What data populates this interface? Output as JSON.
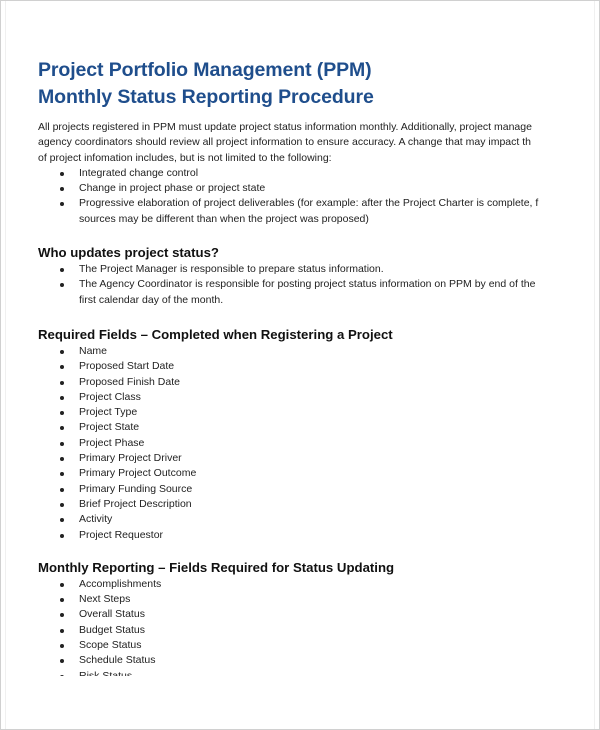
{
  "document": {
    "title_line1": "Project Portfolio Management (PPM)",
    "title_line2": "Monthly Status Reporting Procedure",
    "intro_lines": [
      "All projects registered in PPM must update project status information monthly. Additionally, project manage",
      "agency coordinators should review all project information to ensure accuracy. A change that may impact th",
      "of project infomation includes, but is not limited to the following:"
    ],
    "intro_bullets": [
      {
        "lines": [
          "Integrated change control"
        ]
      },
      {
        "lines": [
          "Change in project phase or project state"
        ]
      },
      {
        "lines": [
          "Progressive elaboration of project deliverables (for example: after the Project Charter is complete, f",
          "sources may be different than when the project was proposed)"
        ]
      }
    ],
    "sections": [
      {
        "heading": "Who updates project status?",
        "bullets": [
          {
            "lines": [
              "The Project Manager is responsible to prepare status information."
            ]
          },
          {
            "lines": [
              "The Agency Coordinator is responsible for posting project status information on PPM by end of the",
              "first calendar day of the month."
            ]
          }
        ]
      },
      {
        "heading": "Required Fields – Completed when Registering a Project",
        "bullets": [
          "Name",
          "Proposed Start Date",
          "Proposed Finish Date",
          "Project Class",
          "Project Type",
          "Project State",
          "Project Phase",
          "Primary Project Driver",
          "Primary Project Outcome",
          "Primary Funding Source",
          "Brief Project Description",
          "Activity",
          "Project Requestor"
        ]
      },
      {
        "heading": "Monthly Reporting – Fields Required for Status Updating",
        "bullets": [
          "Accomplishments",
          "Next Steps",
          "Overall Status",
          "Budget Status",
          "Scope Status",
          "Schedule Status",
          "Risk Status"
        ]
      }
    ]
  }
}
